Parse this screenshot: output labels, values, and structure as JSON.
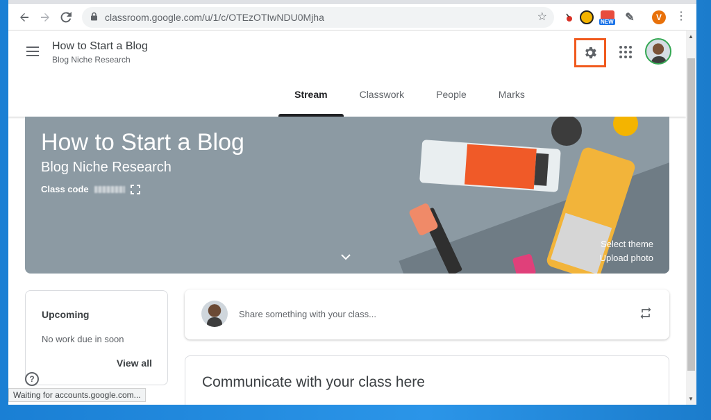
{
  "browser": {
    "url": "classroom.google.com/u/1/c/OTEzOTIwNDU0Mjha",
    "profile_initial": "V",
    "ext_badge": "NEW",
    "status_text": "Waiting for accounts.google.com..."
  },
  "header": {
    "class_title": "How to Start a Blog",
    "class_section": "Blog Niche Research"
  },
  "tabs": [
    {
      "label": "Stream",
      "active": true
    },
    {
      "label": "Classwork"
    },
    {
      "label": "People"
    },
    {
      "label": "Marks"
    }
  ],
  "banner": {
    "title": "How to Start a Blog",
    "subtitle": "Blog Niche Research",
    "class_code_label": "Class code",
    "select_theme": "Select theme",
    "upload_photo": "Upload photo"
  },
  "upcoming": {
    "heading": "Upcoming",
    "empty_text": "No work due in soon",
    "view_all": "View all"
  },
  "share": {
    "placeholder": "Share something with your class..."
  },
  "communicate": {
    "title": "Communicate with your class here"
  },
  "colors": {
    "highlight": "#f05a1e",
    "banner": "#8c9aa3"
  }
}
